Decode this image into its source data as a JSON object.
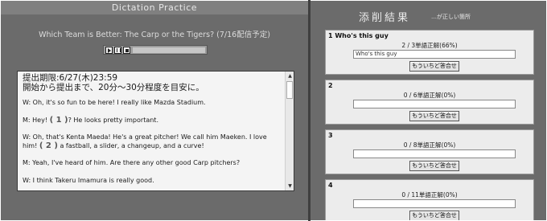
{
  "left": {
    "title": "Dictation Practice",
    "subtitle": "Which Team is Better: The Carp or the Tigers? (7/16配信予定)",
    "deadline": "提出期限:6/27(木)23:59",
    "guide": "開始から提出まで、20分〜30分程度を目安に。",
    "lines": [
      {
        "pre": "W: Oh, it's so fun to be here! I really like Mazda Stadium.",
        "blank": "",
        "post": ""
      },
      {
        "pre": "M: Hey! ",
        "blank": "( 1 )",
        "post": "? He looks pretty important."
      },
      {
        "pre": "W: Oh, that's Kenta Maeda! He's a great pitcher! We call him Maeken. I love him! ",
        "blank": "( 2 )",
        "post": " a fastball, a slider, a changeup, and a curve!"
      },
      {
        "pre": "M: Yeah, I've heard of him. Are there any other good Carp pitchers?",
        "blank": "",
        "post": ""
      },
      {
        "pre": "W: I think Takeru Imamura is really good.",
        "blank": "",
        "post": ""
      }
    ]
  },
  "right": {
    "title": "添削結果",
    "note": "…が正しい箇所",
    "results": [
      {
        "label": "1 Who's this guy",
        "score": "2 / 3単語正解(66%)",
        "answer": "Who's this guy",
        "button": "もういちど答合せ"
      },
      {
        "label": "2",
        "score": "0 / 6単語正解(0%)",
        "answer": "",
        "button": "もういちど答合せ"
      },
      {
        "label": "3",
        "score": "0 / 8単語正解(0%)",
        "answer": "",
        "button": "もういちど答合せ"
      },
      {
        "label": "4",
        "score": "0 / 11単語正解(0%)",
        "answer": "",
        "button": "もういちど答合せ"
      }
    ]
  },
  "icons": {
    "play": "play-icon",
    "pause": "pause-icon",
    "stop": "stop-icon",
    "scroll_up": "arrow-up-icon",
    "scroll_down": "arrow-down-icon"
  }
}
